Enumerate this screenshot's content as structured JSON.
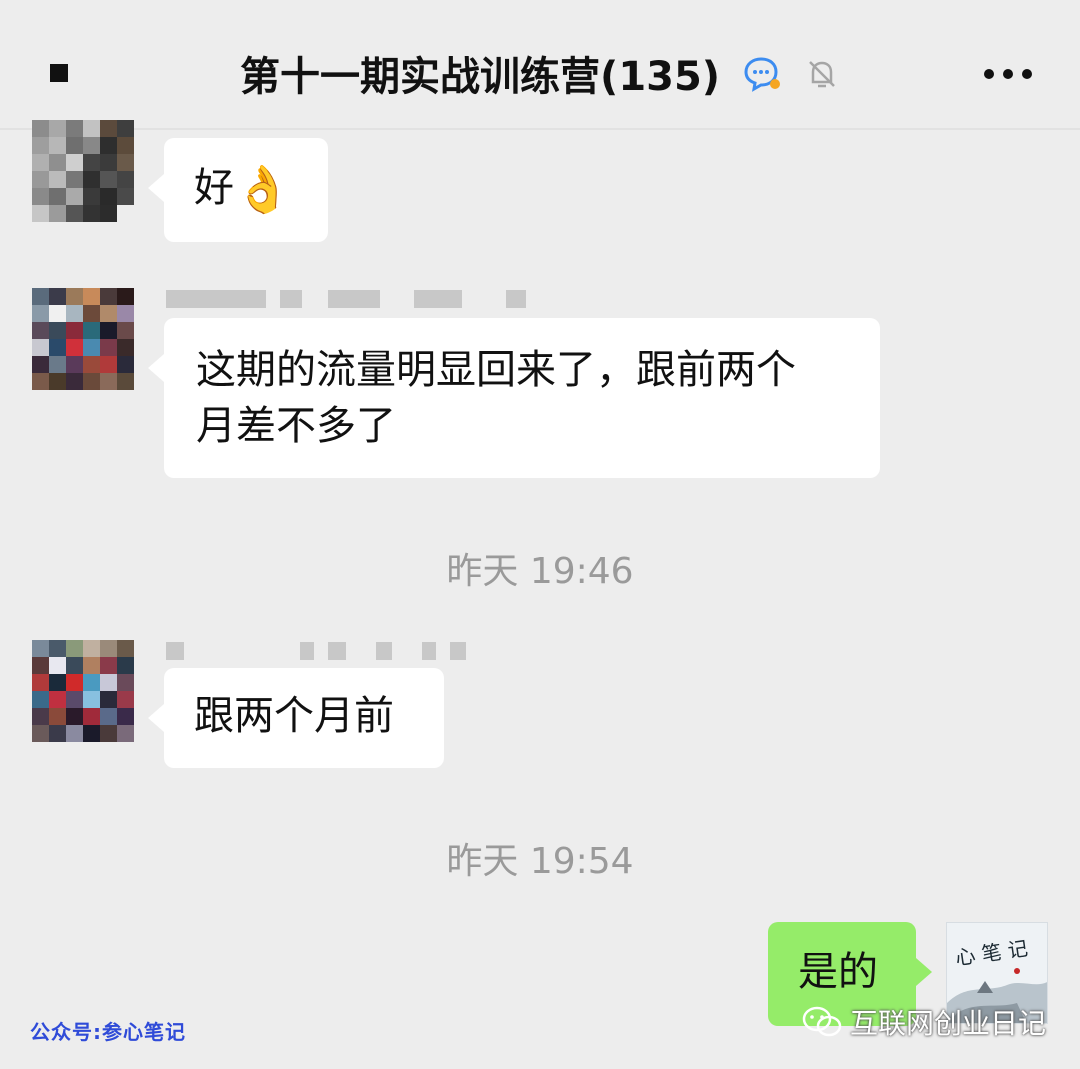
{
  "header": {
    "title": "第十一期实战训练营",
    "member_count": "(135)",
    "icons": [
      "back-icon",
      "chat-bubble-icon",
      "mute-bell-icon",
      "more-icon"
    ]
  },
  "messages": [
    {
      "text": "好",
      "emoji": "👌"
    },
    {
      "text_line1": "这期的流量明显回来了，跟前两个",
      "text_line2": "月差不多了"
    },
    {
      "text": "跟两个月前"
    },
    {
      "text": "是的"
    }
  ],
  "timestamps": [
    "昨天 19:46",
    "昨天 19:54"
  ],
  "watermarks": {
    "left": "公众号:参心笔记",
    "right": "互联网创业日记"
  },
  "my_avatar": {
    "caption": "心 笔 记"
  },
  "colors": {
    "background": "#ededed",
    "bubble_other": "#ffffff",
    "bubble_mine": "#95ec69",
    "timestamp": "#9a9a9a"
  }
}
